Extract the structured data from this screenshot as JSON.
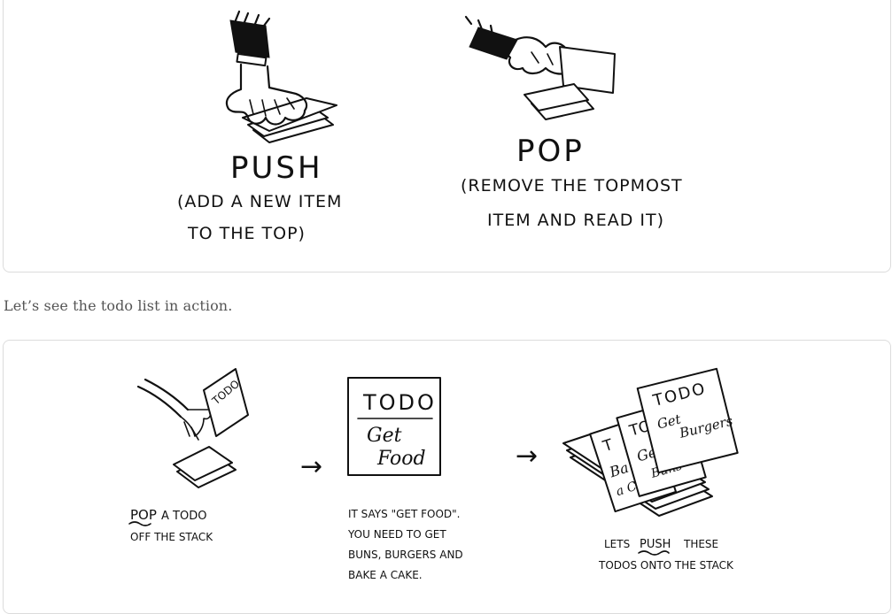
{
  "figure1": {
    "push": {
      "title": "PUSH",
      "line1": "(ADD A NEW ITEM",
      "line2": "TO THE TOP)"
    },
    "pop": {
      "title": "POP",
      "line1": "(REMOVE THE TOPMOST",
      "line2": "ITEM AND READ IT)"
    }
  },
  "caption": "Let’s see the todo list in action.",
  "figure2": {
    "step1": {
      "pop_word": "POP",
      "line1_rest": "A TODO",
      "line2": "OFF THE STACK",
      "note_label": "TODO"
    },
    "arrow": "→",
    "step2": {
      "note_title": "TODO",
      "note_line1": "Get",
      "note_line2": "Food",
      "line1": "IT SAYS \"GET FOOD\".",
      "line2": "YOU NEED TO GET",
      "line3": "BUNS, BURGERS AND",
      "line4": "BAKE A CAKE."
    },
    "step3": {
      "top_note_title": "TODO",
      "top_note_line1": "Get",
      "top_note_line2": "Burgers",
      "mid_note_title": "TO",
      "mid_note_line1": "Ge",
      "mid_note_line2": "Buns",
      "back_note_title": "T",
      "back_note_line1": "Ba",
      "back_note_line2": "a Cake",
      "lets": "LETS",
      "push_word": "PUSH",
      "line1_rest": "THESE",
      "line2": "TODOS ONTO THE STACK"
    }
  }
}
